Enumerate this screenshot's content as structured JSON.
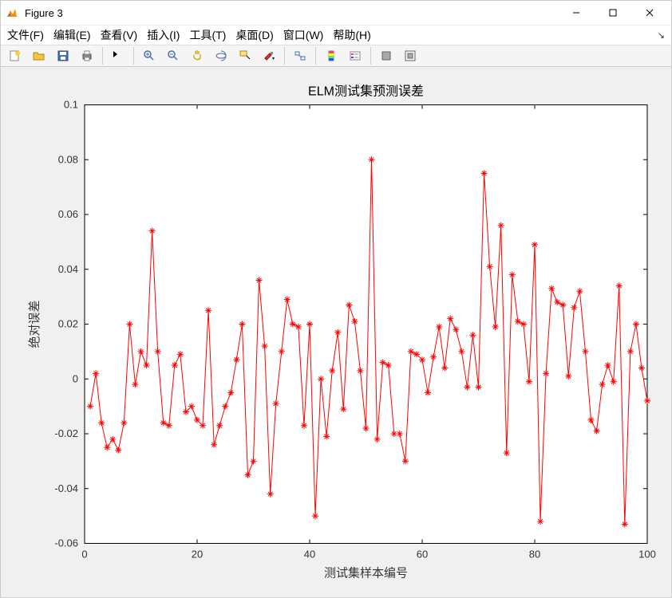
{
  "window": {
    "title": "Figure 3"
  },
  "menu": {
    "file": "文件(F)",
    "edit": "编辑(E)",
    "view": "查看(V)",
    "insert": "插入(I)",
    "tools": "工具(T)",
    "desktop": "桌面(D)",
    "window": "窗口(W)",
    "help": "帮助(H)"
  },
  "toolbar_icons": {
    "new": "new-figure-icon",
    "open": "open-icon",
    "save": "save-icon",
    "print": "print-icon",
    "pointer": "pointer-icon",
    "zoom_in": "zoom-in-icon",
    "zoom_out": "zoom-out-icon",
    "pan": "pan-icon",
    "rotate": "rotate-3d-icon",
    "data_cursor": "data-cursor-icon",
    "brush": "brush-icon",
    "link": "link-plot-icon",
    "colorbar": "colorbar-icon",
    "legend": "legend-icon",
    "hide_tools": "hide-tools-icon",
    "dock": "dock-icon"
  },
  "chart_data": {
    "type": "line",
    "title": "ELM测试集预测误差",
    "xlabel": "测试集样本编号",
    "ylabel": "绝对误差",
    "xlim": [
      0,
      100
    ],
    "ylim": [
      -0.06,
      0.1
    ],
    "xticks": [
      0,
      20,
      40,
      60,
      80,
      100
    ],
    "yticks": [
      -0.06,
      -0.04,
      -0.02,
      0,
      0.02,
      0.04,
      0.06,
      0.08,
      0.1
    ],
    "marker": "*",
    "color": "#ff0000",
    "x": [
      1,
      2,
      3,
      4,
      5,
      6,
      7,
      8,
      9,
      10,
      11,
      12,
      13,
      14,
      15,
      16,
      17,
      18,
      19,
      20,
      21,
      22,
      23,
      24,
      25,
      26,
      27,
      28,
      29,
      30,
      31,
      32,
      33,
      34,
      35,
      36,
      37,
      38,
      39,
      40,
      41,
      42,
      43,
      44,
      45,
      46,
      47,
      48,
      49,
      50,
      51,
      52,
      53,
      54,
      55,
      56,
      57,
      58,
      59,
      60,
      61,
      62,
      63,
      64,
      65,
      66,
      67,
      68,
      69,
      70,
      71,
      72,
      73,
      74,
      75,
      76,
      77,
      78,
      79,
      80,
      81,
      82,
      83,
      84,
      85,
      86,
      87,
      88,
      89,
      90,
      91,
      92,
      93,
      94,
      95,
      96,
      97,
      98,
      99,
      100
    ],
    "values": [
      -0.01,
      0.002,
      -0.016,
      -0.025,
      -0.022,
      -0.026,
      -0.016,
      0.02,
      -0.002,
      0.01,
      0.005,
      0.054,
      0.01,
      -0.016,
      -0.017,
      0.005,
      0.009,
      -0.012,
      -0.01,
      -0.015,
      -0.017,
      0.025,
      -0.024,
      -0.017,
      -0.01,
      -0.005,
      0.007,
      0.02,
      -0.035,
      -0.03,
      0.036,
      0.012,
      -0.042,
      -0.009,
      0.01,
      0.029,
      0.02,
      0.019,
      -0.017,
      0.02,
      -0.05,
      0.0,
      -0.021,
      0.003,
      0.017,
      -0.011,
      0.027,
      0.021,
      0.003,
      -0.018,
      0.08,
      -0.022,
      0.006,
      0.005,
      -0.02,
      -0.02,
      -0.03,
      0.01,
      0.009,
      0.007,
      -0.005,
      0.008,
      0.019,
      0.004,
      0.022,
      0.018,
      0.01,
      -0.003,
      0.016,
      -0.003,
      0.075,
      0.041,
      0.019,
      0.056,
      -0.027,
      0.038,
      0.021,
      0.02,
      -0.001,
      0.049,
      -0.052,
      0.002,
      0.033,
      0.028,
      0.027,
      0.001,
      0.026,
      0.032,
      0.01,
      -0.015,
      -0.019,
      -0.002,
      0.005,
      -0.001,
      0.034,
      -0.053,
      0.01,
      0.02,
      0.004,
      -0.008
    ]
  }
}
